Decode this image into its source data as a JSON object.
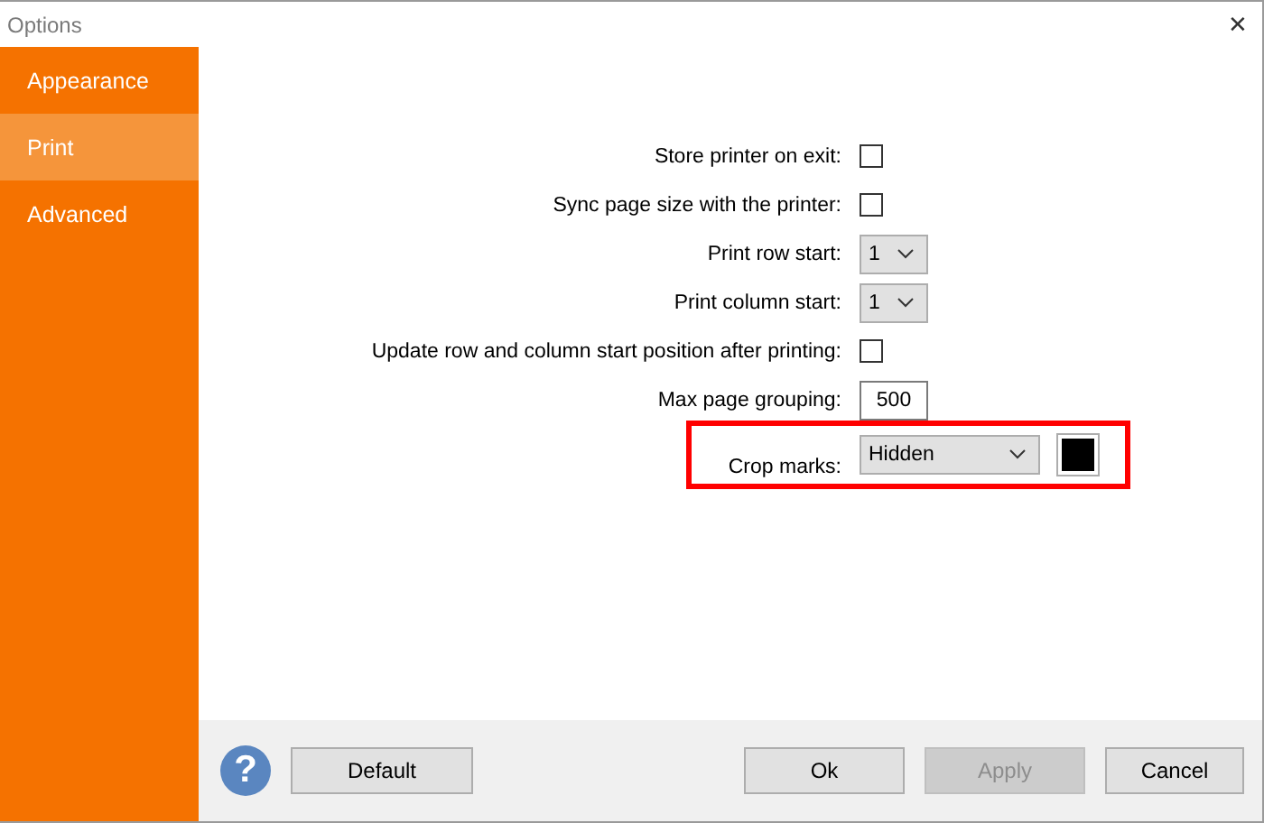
{
  "window": {
    "title": "Options",
    "close": "✕"
  },
  "sidebar": {
    "items": [
      {
        "label": "Appearance",
        "selected": false
      },
      {
        "label": "Print",
        "selected": true
      },
      {
        "label": "Advanced",
        "selected": false
      }
    ]
  },
  "form": {
    "rows": [
      {
        "kind": "checkbox",
        "label": "Store printer on exit:",
        "checked": false
      },
      {
        "kind": "checkbox",
        "label": "Sync page size with the printer:",
        "checked": false
      },
      {
        "kind": "select",
        "label": "Print row start:",
        "value": "1"
      },
      {
        "kind": "select",
        "label": "Print column start:",
        "value": "1"
      },
      {
        "kind": "checkbox",
        "label": "Update row and column start position after printing:",
        "checked": false
      },
      {
        "kind": "number",
        "label": "Max page grouping:",
        "value": "500"
      },
      {
        "kind": "select_color",
        "label": "Crop marks:",
        "value": "Hidden",
        "color": "#000000",
        "highlighted": true
      }
    ]
  },
  "footer": {
    "help": "?",
    "left_buttons": [
      {
        "label": "Default",
        "disabled": false
      }
    ],
    "right_buttons": [
      {
        "label": "Ok",
        "disabled": false
      },
      {
        "label": "Apply",
        "disabled": true
      },
      {
        "label": "Cancel",
        "disabled": false
      }
    ]
  }
}
